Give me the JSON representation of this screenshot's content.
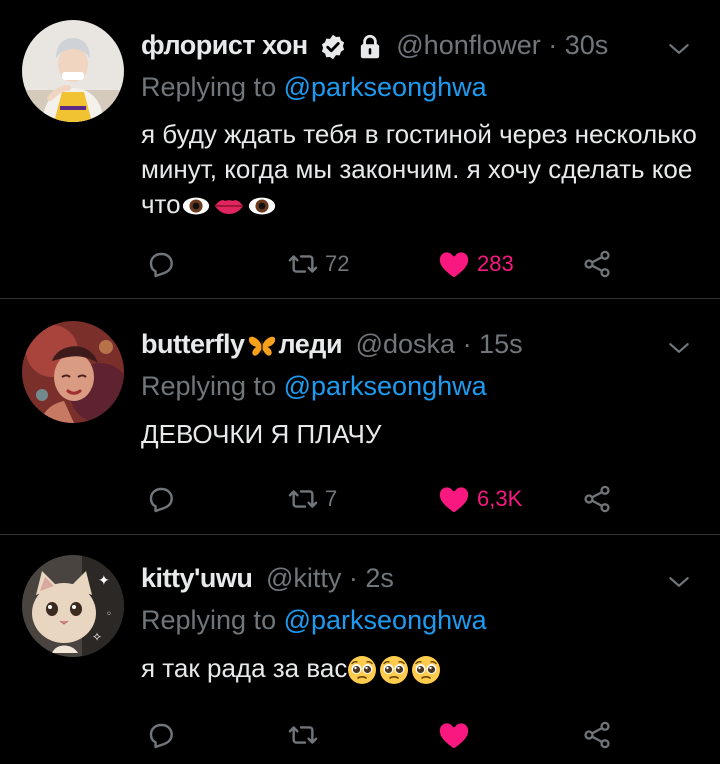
{
  "tweets": [
    {
      "name": "флорист хон",
      "verified": true,
      "protected": true,
      "handle": "@honflower",
      "time": "· 30s",
      "reply_prefix": "Replying to",
      "reply_to": "@parkseonghwa",
      "text": "я буду ждать тебя в гостиной через несколько минут, когда мы закончим. я хочу сделать кое что",
      "emojis": [
        "eye-emoji",
        "lips-emoji",
        "eye-emoji"
      ],
      "retweets": "72",
      "likes": "283",
      "liked": true
    },
    {
      "name": "butterfly",
      "name_suffix": "леди",
      "name_emoji": "butterfly-emoji",
      "handle": "@doska",
      "time": "· 15s",
      "reply_prefix": "Replying to",
      "reply_to": "@parkseonghwa",
      "text": "ДЕВОЧКИ Я ПЛАЧУ",
      "retweets": "7",
      "likes": "6,3K",
      "liked": true
    },
    {
      "name": "kitty'uwu",
      "handle": "@kitty",
      "time": "· 2s",
      "reply_prefix": "Replying to",
      "reply_to": "@parkseonghwa",
      "text": "я так рада за вас",
      "emojis": [
        "pleading-face-emoji",
        "pleading-face-emoji",
        "pleading-face-emoji"
      ],
      "retweets": "",
      "likes": "",
      "liked": true
    }
  ],
  "colors": {
    "background": "#000000",
    "text": "#e7e9ea",
    "muted": "#71767b",
    "link": "#1d9bf0",
    "like": "#f91880",
    "divider": "#2f3336"
  }
}
